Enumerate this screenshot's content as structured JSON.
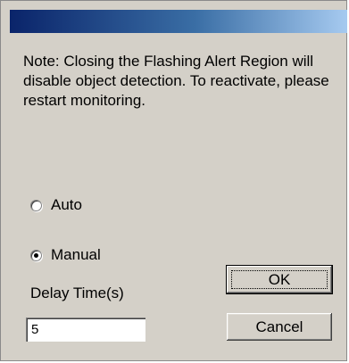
{
  "dialog": {
    "title": "",
    "note": "Note: Closing the Flashing Alert Region will disable object detection. To reactivate, please restart monitoring."
  },
  "mode": {
    "options": [
      {
        "label": "Auto",
        "checked": false
      },
      {
        "label": "Manual",
        "checked": true
      }
    ]
  },
  "delay": {
    "label": "Delay Time(s)",
    "value": "5"
  },
  "buttons": {
    "ok_label": "OK",
    "cancel_label": "Cancel"
  },
  "colors": {
    "titlebar_start": "#0a246a",
    "titlebar_end": "#a6caf0",
    "dialog_bg": "#d4d0c8"
  }
}
